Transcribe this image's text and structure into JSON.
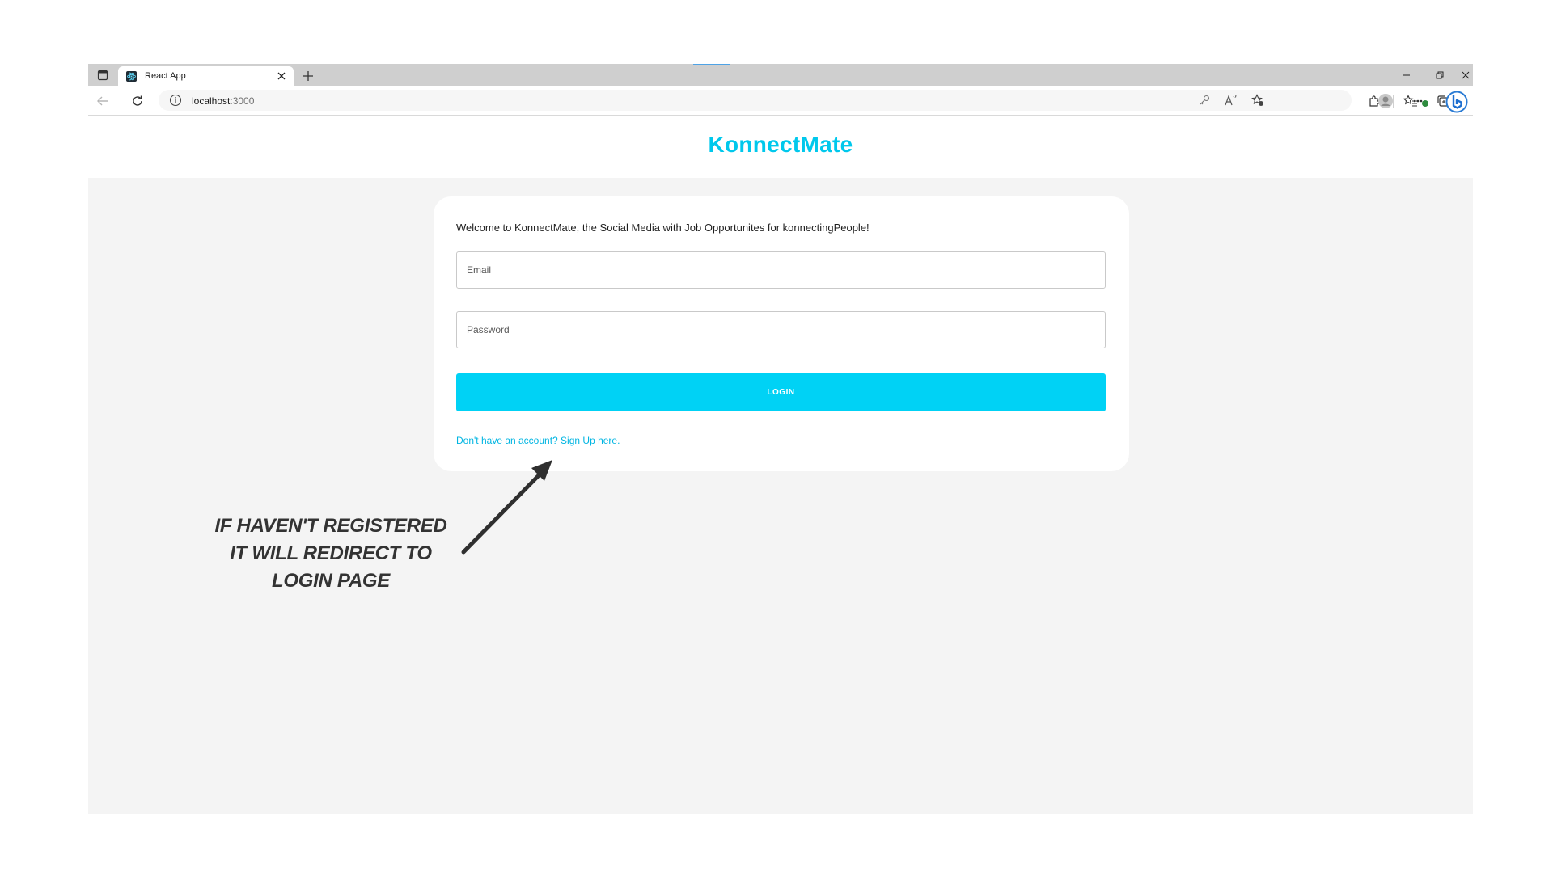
{
  "browser": {
    "tab": {
      "title": "React App"
    },
    "address": {
      "host": "localhost",
      "port": ":3000"
    }
  },
  "app": {
    "brand": "KonnectMate",
    "brand_color": "#00c8ec",
    "welcome": "Welcome to KonnectMate, the Social Media with Job Opportunites for konnectingPeople!",
    "email_placeholder": "Email",
    "password_placeholder": "Password",
    "login_label": "LOGIN",
    "login_color": "#00d2f5",
    "signup_link": "Don't have an account? Sign Up here."
  },
  "annotation": {
    "text": "IF HAVEN'T REGISTERED\nIT WILL REDIRECT TO\nLOGIN PAGE"
  },
  "icons": [
    "tab-actions-icon",
    "react-favicon-icon",
    "close-icon",
    "plus-icon",
    "minimize-icon",
    "restore-icon",
    "back-arrow-icon",
    "refresh-icon",
    "info-icon",
    "key-icon",
    "read-aloud-icon",
    "favorite-add-icon",
    "extensions-icon",
    "favorites-icon",
    "collections-icon",
    "profile-icon",
    "more-icon",
    "bing-icon",
    "annotation-arrow-icon"
  ]
}
